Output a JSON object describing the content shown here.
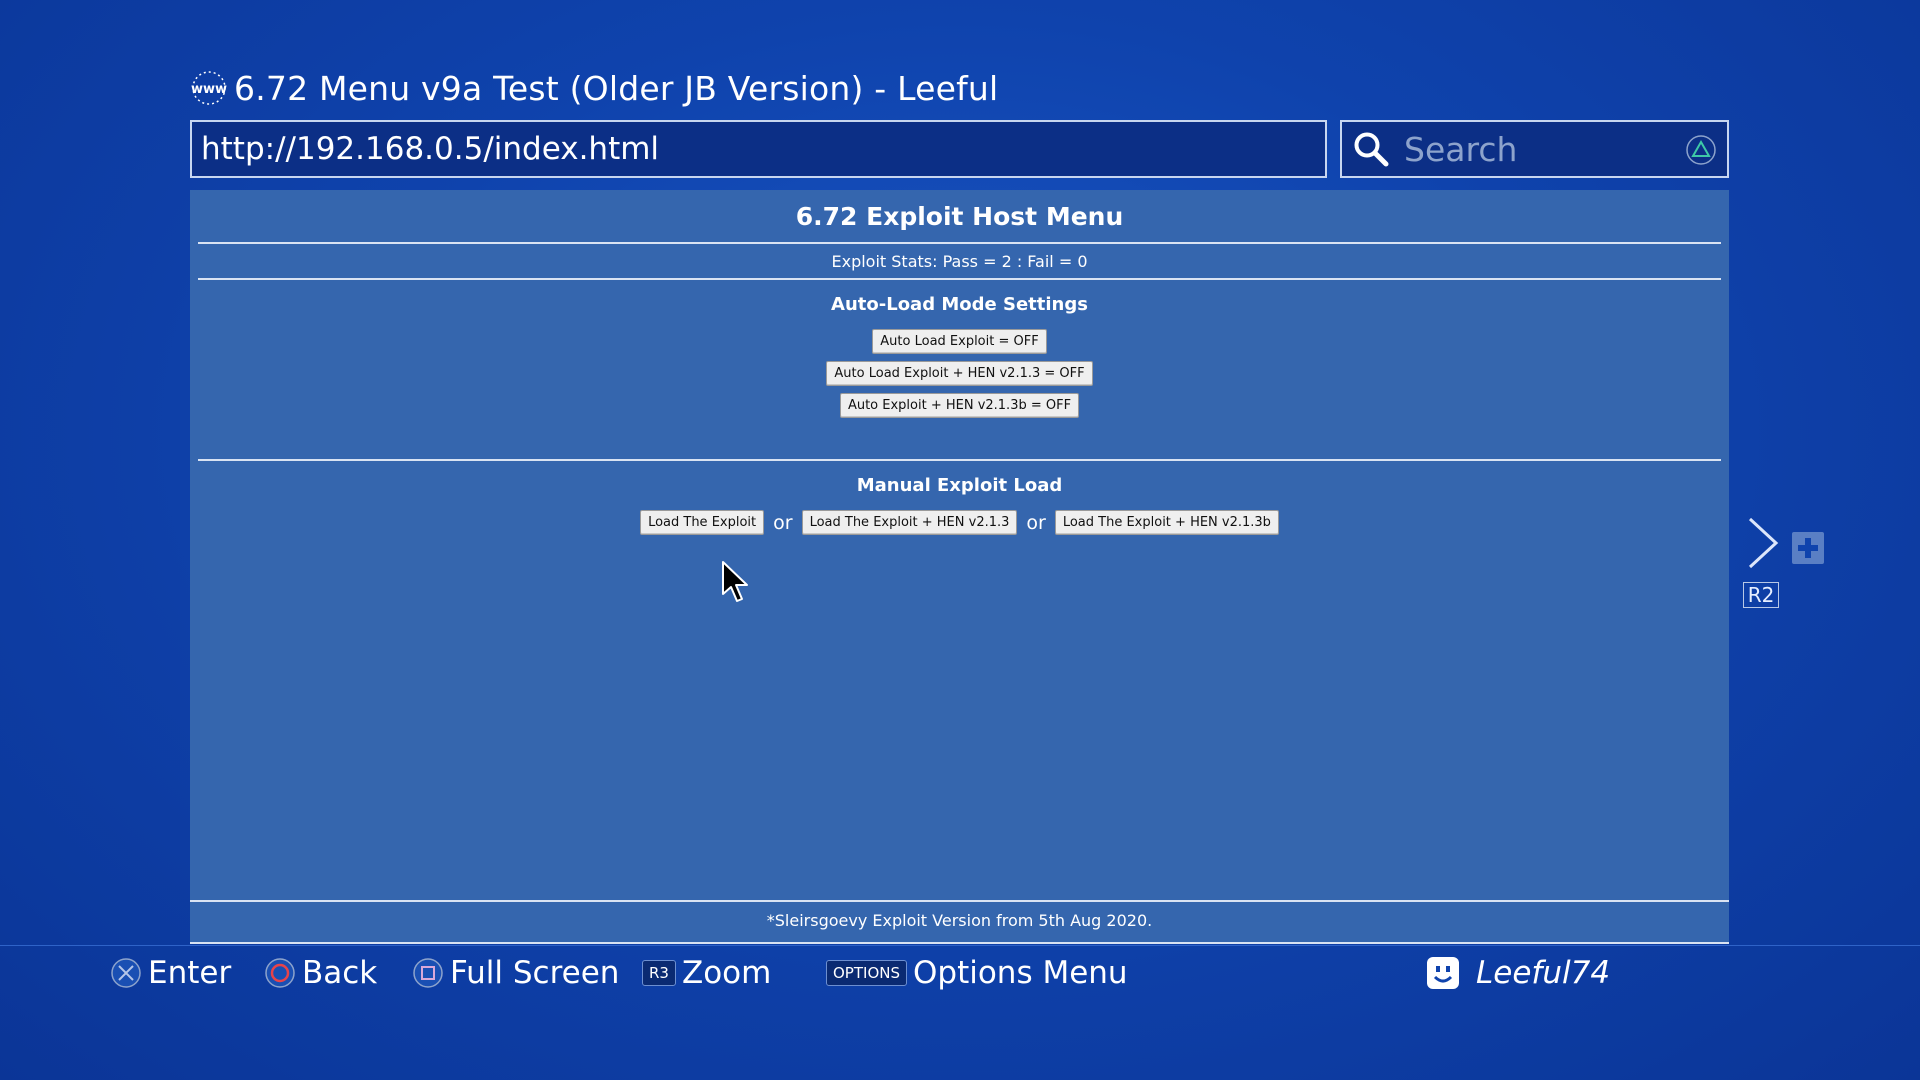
{
  "window": {
    "title": "6.72 Menu v9a Test (Older JB Version) - Leeful"
  },
  "address_bar": {
    "url": "http://192.168.0.5/index.html"
  },
  "search": {
    "placeholder": "Search"
  },
  "page": {
    "heading": "6.72 Exploit Host Menu",
    "stats": "Exploit Stats:  Pass = 2   :   Fail = 0",
    "auto_section": {
      "heading": "Auto-Load Mode Settings",
      "buttons": [
        "Auto Load Exploit = OFF",
        "Auto Load Exploit + HEN v2.1.3 = OFF",
        "Auto Exploit + HEN v2.1.3b = OFF"
      ]
    },
    "manual_section": {
      "heading": "Manual Exploit Load",
      "buttons": [
        "Load The Exploit",
        "Load The Exploit + HEN v2.1.3",
        "Load The Exploit + HEN v2.1.3b"
      ],
      "separator": "or"
    },
    "footer": "*Sleirsgoevy Exploit Version from 5th Aug 2020."
  },
  "side_controls": {
    "r2_label": "R2"
  },
  "hints": {
    "enter": "Enter",
    "back": "Back",
    "full_screen": "Full Screen",
    "r3_key": "R3",
    "zoom": "Zoom",
    "options_key": "OPTIONS",
    "options_menu": "Options Menu"
  },
  "user": {
    "name": "Leeful74"
  },
  "colors": {
    "background": "#0f43ad",
    "page_bg": "#3566ae",
    "url_bg": "#0c2f86",
    "triangle": "#3ec9a7",
    "circle": "#e8434a"
  }
}
